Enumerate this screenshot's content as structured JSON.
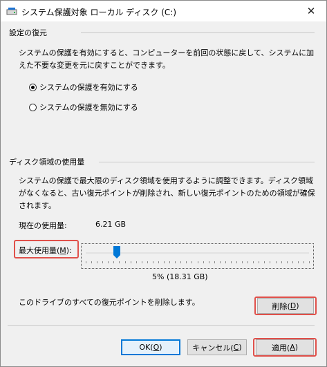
{
  "window": {
    "title": "システム保護対象 ローカル ディスク (C:)",
    "close_symbol": "✕"
  },
  "restore": {
    "group_label": "設定の復元",
    "description": "システムの保護を有効にすると、コンピューターを前回の状態に戻して、システムに加えた不要な変更を元に戻すことができます。",
    "options": [
      {
        "label": "システムの保護を有効にする",
        "checked": true
      },
      {
        "label": "システムの保護を無効にする",
        "checked": false
      }
    ]
  },
  "usage": {
    "group_label": "ディスク領域の使用量",
    "description": "システムの保護で最大限のディスク領域を使用するように調整できます。ディスク領域がなくなると、古い復元ポイントが削除され、新しい復元ポイントのための領域が確保されます。",
    "current_label": "現在の使用量:",
    "current_value": "6.21 GB",
    "max_label_prefix": "最大使用量(",
    "max_label_mnemonic": "M",
    "max_label_suffix": "):",
    "slider_percent": 5,
    "slider_value_text": "5% (18.31 GB)",
    "delete_text": "このドライブのすべての復元ポイントを削除します。",
    "delete_button": {
      "prefix": "削除(",
      "mnemonic": "D",
      "suffix": ")"
    }
  },
  "footer": {
    "ok": {
      "prefix": "OK(",
      "mnemonic": "O",
      "suffix": ")"
    },
    "cancel": {
      "prefix": "キャンセル(",
      "mnemonic": "C",
      "suffix": ")"
    },
    "apply": {
      "prefix": "適用(",
      "mnemonic": "A",
      "suffix": ")"
    }
  },
  "colors": {
    "highlight": "#e0504a",
    "accent": "#0078d7"
  }
}
